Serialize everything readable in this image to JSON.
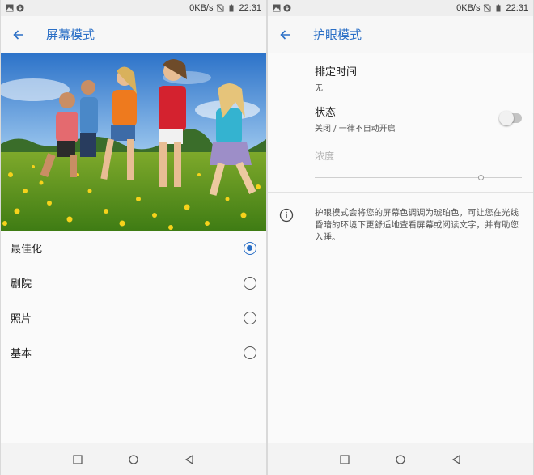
{
  "status_bar": {
    "speed": "0KB/s",
    "time": "22:31"
  },
  "screen_mode": {
    "title": "屏幕模式",
    "options": [
      {
        "label": "最佳化",
        "selected": true
      },
      {
        "label": "剧院",
        "selected": false
      },
      {
        "label": "照片",
        "selected": false
      },
      {
        "label": "基本",
        "selected": false
      }
    ]
  },
  "eye_care": {
    "title": "护眼模式",
    "schedule": {
      "title": "排定时间",
      "value": "无"
    },
    "status": {
      "title": "状态",
      "value": "关闭 / 一律不自动开启",
      "enabled": false
    },
    "intensity": {
      "label": "浓度",
      "level": 0.8
    },
    "description": "护眼模式会将您的屏幕色调调为琥珀色，可让您在光线昏暗的环境下更舒适地查看屏幕或阅读文字，并有助您入睡。"
  },
  "colors": {
    "accent": "#2a6fc6"
  }
}
